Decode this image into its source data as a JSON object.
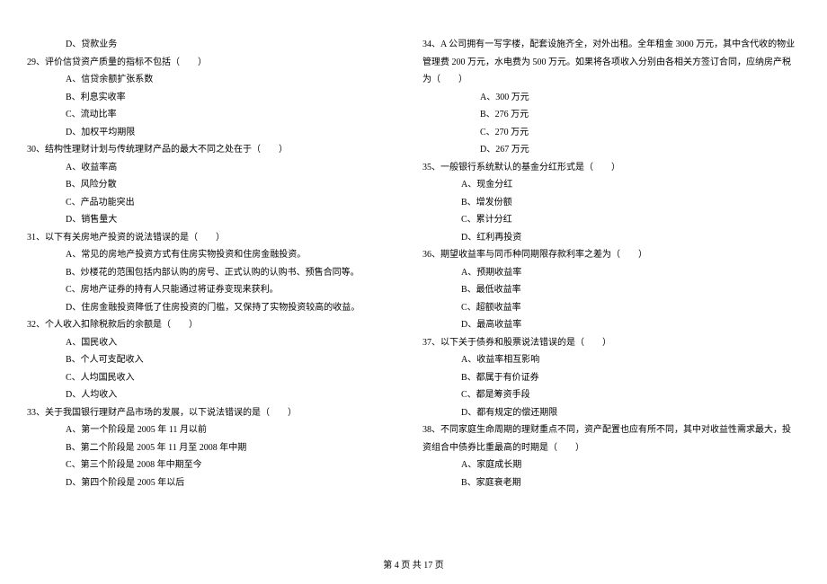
{
  "leftColumn": [
    {
      "type": "option",
      "text": "D、贷款业务",
      "indent": "opt"
    },
    {
      "type": "stem",
      "text": "29、评价信贷资产质量的指标不包括（　　）"
    },
    {
      "type": "option",
      "text": "A、信贷余额扩张系数",
      "indent": "opt"
    },
    {
      "type": "option",
      "text": "B、利息实收率",
      "indent": "opt"
    },
    {
      "type": "option",
      "text": "C、流动比率",
      "indent": "opt"
    },
    {
      "type": "option",
      "text": "D、加权平均期限",
      "indent": "opt"
    },
    {
      "type": "stem",
      "text": "30、结构性理财计划与传统理财产品的最大不同之处在于（　　）"
    },
    {
      "type": "option",
      "text": "A、收益率高",
      "indent": "opt"
    },
    {
      "type": "option",
      "text": "B、风险分散",
      "indent": "opt"
    },
    {
      "type": "option",
      "text": "C、产品功能突出",
      "indent": "opt"
    },
    {
      "type": "option",
      "text": "D、销售量大",
      "indent": "opt"
    },
    {
      "type": "stem",
      "text": "31、以下有关房地产投资的说法错误的是（　　）"
    },
    {
      "type": "option",
      "text": "A、常见的房地产投资方式有住房实物投资和住房金融投资。",
      "indent": "opt"
    },
    {
      "type": "option",
      "text": "B、炒楼花的范围包括内部认购的房号、正式认购的认购书、预售合同等。",
      "indent": "opt"
    },
    {
      "type": "option",
      "text": "C、房地产证券的持有人只能通过将证券变现来获利。",
      "indent": "opt"
    },
    {
      "type": "option",
      "text": "D、住房金融投资降低了住房投资的门槛，又保持了实物投资较高的收益。",
      "indent": "opt"
    },
    {
      "type": "stem",
      "text": "32、个人收入扣除税款后的余额是（　　）"
    },
    {
      "type": "option",
      "text": "A、国民收入",
      "indent": "opt"
    },
    {
      "type": "option",
      "text": "B、个人可支配收入",
      "indent": "opt"
    },
    {
      "type": "option",
      "text": "C、人均国民收入",
      "indent": "opt"
    },
    {
      "type": "option",
      "text": "D、人均收入",
      "indent": "opt"
    },
    {
      "type": "stem",
      "text": "33、关于我国银行理财产品市场的发展，以下说法错误的是（　　）"
    },
    {
      "type": "option",
      "text": "A、第一个阶段是 2005 年 11 月以前",
      "indent": "opt"
    },
    {
      "type": "option",
      "text": "B、第二个阶段是 2005 年 11 月至 2008 年中期",
      "indent": "opt"
    },
    {
      "type": "option",
      "text": "C、第三个阶段是 2008 年中期至今",
      "indent": "opt"
    },
    {
      "type": "option",
      "text": "D、第四个阶段是 2005 年以后",
      "indent": "opt"
    }
  ],
  "rightColumn": [
    {
      "type": "stem",
      "text": "34、A 公司拥有一写字楼，配套设施齐全，对外出租。全年租金 3000 万元，其中含代收的物业"
    },
    {
      "type": "cont",
      "text": "管理费 200 万元，水电费为 500 万元。如果将各项收入分别由各相关方签订合同，应纳房产税"
    },
    {
      "type": "cont",
      "text": "为（　　）"
    },
    {
      "type": "option",
      "text": "A、300 万元",
      "indent": "opt2"
    },
    {
      "type": "option",
      "text": "B、276 万元",
      "indent": "opt2"
    },
    {
      "type": "option",
      "text": "C、270 万元",
      "indent": "opt2"
    },
    {
      "type": "option",
      "text": "D、267 万元",
      "indent": "opt2"
    },
    {
      "type": "stem",
      "text": "35、一般银行系统默认的基金分红形式是（　　）"
    },
    {
      "type": "option",
      "text": "A、现金分红",
      "indent": "opt"
    },
    {
      "type": "option",
      "text": "B、增发份额",
      "indent": "opt"
    },
    {
      "type": "option",
      "text": "C、累计分红",
      "indent": "opt"
    },
    {
      "type": "option",
      "text": "D、红利再投资",
      "indent": "opt"
    },
    {
      "type": "stem",
      "text": "36、期望收益率与同币种同期限存款利率之差为（　　）"
    },
    {
      "type": "option",
      "text": "A、预期收益率",
      "indent": "opt"
    },
    {
      "type": "option",
      "text": "B、最低收益率",
      "indent": "opt"
    },
    {
      "type": "option",
      "text": "C、超额收益率",
      "indent": "opt"
    },
    {
      "type": "option",
      "text": "D、最高收益率",
      "indent": "opt"
    },
    {
      "type": "stem",
      "text": "37、以下关于债券和股票说法错误的是（　　）"
    },
    {
      "type": "option",
      "text": "A、收益率相互影响",
      "indent": "opt"
    },
    {
      "type": "option",
      "text": "B、都属于有价证券",
      "indent": "opt"
    },
    {
      "type": "option",
      "text": "C、都是筹资手段",
      "indent": "opt"
    },
    {
      "type": "option",
      "text": "D、都有规定的偿还期限",
      "indent": "opt"
    },
    {
      "type": "stem",
      "text": "38、不同家庭生命周期的理财重点不同，资产配置也应有所不同，其中对收益性需求最大，投"
    },
    {
      "type": "cont",
      "text": "资组合中债券比重最高的时期是（　　）"
    },
    {
      "type": "option",
      "text": "A、家庭成长期",
      "indent": "opt"
    },
    {
      "type": "option",
      "text": "B、家庭衰老期",
      "indent": "opt"
    }
  ],
  "footer": "第 4 页 共 17 页"
}
